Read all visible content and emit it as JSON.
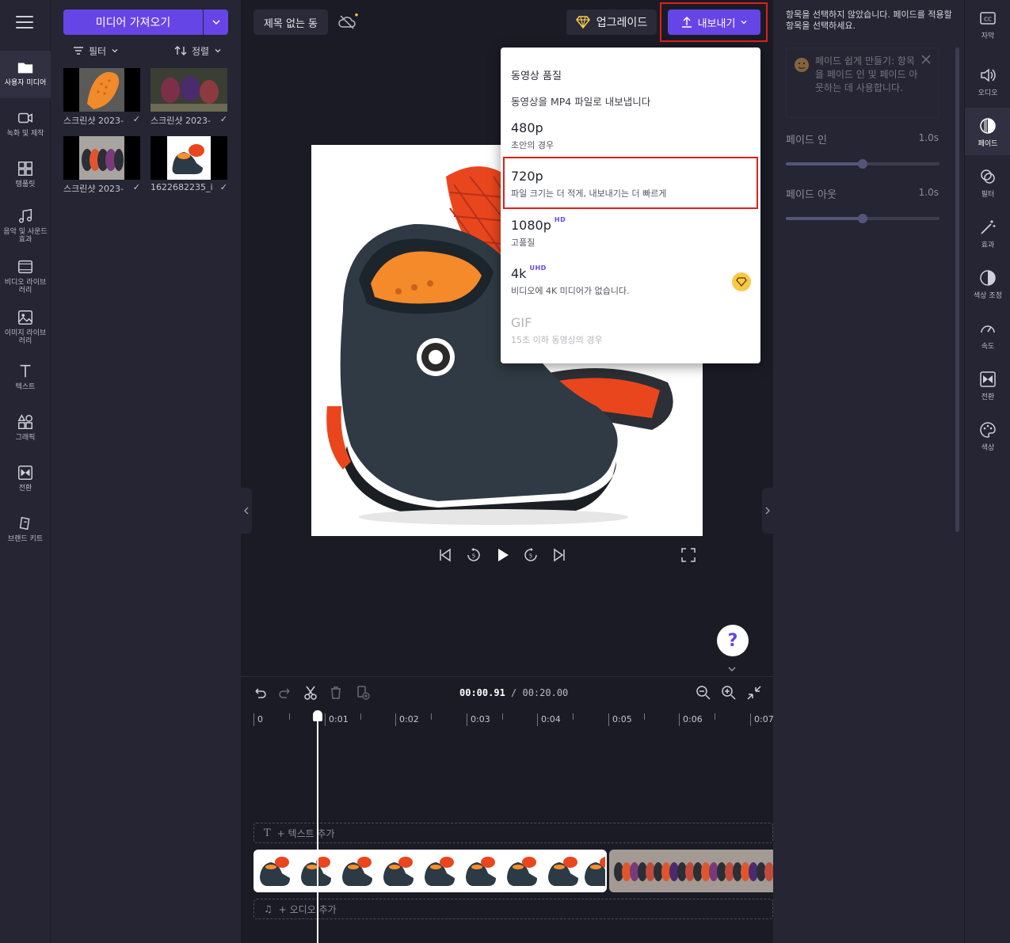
{
  "left_rail": {
    "items": [
      {
        "label": "사용자 미디어",
        "icon": "folder-icon"
      },
      {
        "label": "녹화 및 제작",
        "icon": "camera-icon"
      },
      {
        "label": "템플릿",
        "icon": "templates-icon"
      },
      {
        "label": "음악 및 사운드 효과",
        "icon": "music-icon"
      },
      {
        "label": "비디오 라이브러리",
        "icon": "film-icon"
      },
      {
        "label": "이미지 라이브러리",
        "icon": "image-icon"
      },
      {
        "label": "텍스트",
        "icon": "text-icon"
      },
      {
        "label": "그래픽",
        "icon": "shapes-icon"
      },
      {
        "label": "전환",
        "icon": "transition-icon"
      },
      {
        "label": "브랜드 키트",
        "icon": "brand-kit-icon"
      }
    ]
  },
  "media_panel": {
    "import_label": "미디어 가져오기",
    "filter_label": "필터",
    "sort_label": "정렬",
    "items": [
      {
        "caption": "스크린샷 2023-"
      },
      {
        "caption": "스크린샷 2023-"
      },
      {
        "caption": "스크린샷 2023-"
      },
      {
        "caption": "1622682235_i"
      }
    ]
  },
  "header": {
    "project_title": "제목 없는 동",
    "upgrade_label": "업그레이드",
    "export_label": "내보내기"
  },
  "export_menu": {
    "header": "동영상 품질",
    "subtitle": "동영상을 MP4 파일로 내보냅니다",
    "options": [
      {
        "title": "480p",
        "desc": "초안의 경우",
        "badge": ""
      },
      {
        "title": "720p",
        "desc": "파일 크기는 더 적게, 내보내기는 더 빠르게",
        "badge": ""
      },
      {
        "title": "1080p",
        "desc": "고품질",
        "badge": "HD"
      },
      {
        "title": "4k",
        "desc": "비디오에 4K 미디어가 없습니다.",
        "badge": "UHD"
      },
      {
        "title": "GIF",
        "desc": "15초 이하 동영상의 경우",
        "badge": ""
      }
    ]
  },
  "timeline": {
    "current_time": "00:00.91",
    "total_time": "/ 00:20.00",
    "ticks": [
      "0",
      "0:01",
      "0:02",
      "0:03",
      "0:04",
      "0:05",
      "0:06",
      "0:07"
    ],
    "add_text_label": "+ 텍스트 추가",
    "add_audio_label": "+ 오디오 추가"
  },
  "props": {
    "message": "항목을 선택하지 않았습니다. 페이드를 적용할 항목을 선택하세요.",
    "tip": "페이드 쉽게 만들기: 항목을 페이드 인 및 페이드 아웃하는 데 사용합니다.",
    "fade_in_label": "페이드 인",
    "fade_in_value": "1.0s",
    "fade_in_level": 0.5,
    "fade_out_label": "페이드 아웃",
    "fade_out_value": "1.0s",
    "fade_out_level": 0.5
  },
  "right_rail": {
    "items": [
      {
        "label": "자막",
        "icon": "captions-icon"
      },
      {
        "label": "오디오",
        "icon": "speaker-icon"
      },
      {
        "label": "페이드",
        "icon": "fade-icon"
      },
      {
        "label": "필터",
        "icon": "filter-icon"
      },
      {
        "label": "효과",
        "icon": "magic-wand-icon"
      },
      {
        "label": "색상 조정",
        "icon": "contrast-icon"
      },
      {
        "label": "속도",
        "icon": "speed-icon"
      },
      {
        "label": "전환",
        "icon": "transition-icon"
      },
      {
        "label": "색상",
        "icon": "palette-icon"
      }
    ]
  },
  "colors": {
    "accent": "#6645e6",
    "highlight": "#e0201a",
    "panel": "#252533",
    "background": "#1b1b26"
  }
}
